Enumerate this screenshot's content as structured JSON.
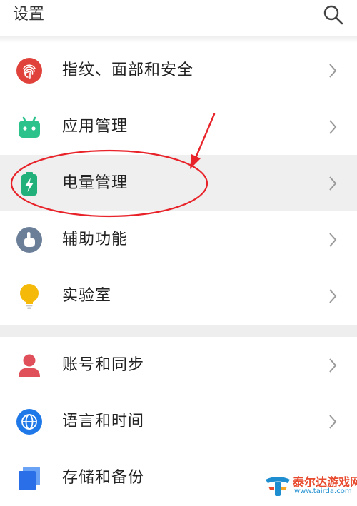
{
  "header": {
    "title": "设置",
    "search_icon": "search-icon"
  },
  "settings_items": [
    {
      "label": "指纹、面部和安全",
      "icon": "fingerprint-icon",
      "color": "#e0413a"
    },
    {
      "label": "应用管理",
      "icon": "android-icon",
      "color": "#2bc28c"
    },
    {
      "label": "电量管理",
      "icon": "battery-icon",
      "color": "#22b07a",
      "highlighted": true
    },
    {
      "label": "辅助功能",
      "icon": "hand-icon",
      "color": "#6b7f99"
    },
    {
      "label": "实验室",
      "icon": "lightbulb-icon",
      "color": "#f5b90a"
    },
    {
      "label": "账号和同步",
      "icon": "person-icon",
      "color": "#e0505a"
    },
    {
      "label": "语言和时间",
      "icon": "globe-icon",
      "color": "#1f78e8"
    },
    {
      "label": "存储和备份",
      "icon": "storage-icon",
      "color": "#2a6fe8"
    }
  ],
  "annotation": {
    "color": "#e8232a"
  },
  "watermark": {
    "name": "泰尔达游戏网",
    "url": "www.tairda.com"
  }
}
